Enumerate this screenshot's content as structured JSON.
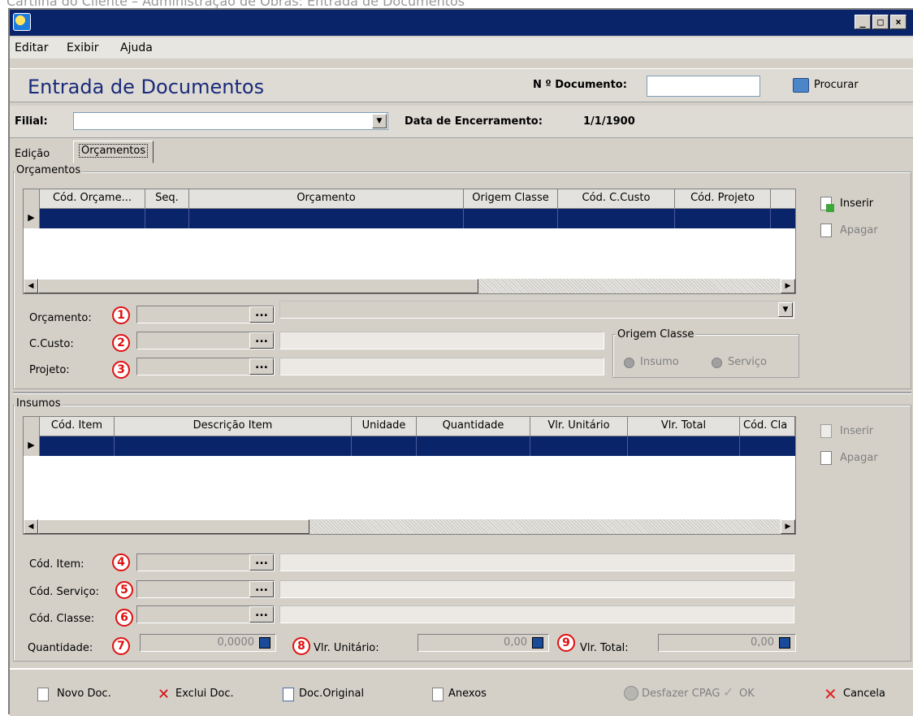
{
  "caption": "Cartilha do Cliente – Administração de Obras: Entrada de Documentos",
  "window": {
    "min_label": "_",
    "max_label": "□",
    "close_label": "×"
  },
  "menu": [
    "Editar",
    "Exibir",
    "Ajuda"
  ],
  "header": {
    "title": "Entrada de Documentos",
    "doc_number_label": "N º Documento:",
    "doc_number_value": "",
    "search_label": "Procurar"
  },
  "filter": {
    "filial_label": "Filial:",
    "filial_value": "",
    "closing_label": "Data de Encerramento:",
    "closing_value": "1/1/1900"
  },
  "tabs": [
    "Edição",
    "Orçamentos"
  ],
  "orcamentos": {
    "title": "Orçamentos",
    "columns": [
      "Cód. Orçame...",
      "Seq.",
      "Orçamento",
      "Origem Classe",
      "Cód. C.Custo",
      "Cód. Projeto"
    ],
    "insert_label": "Inserir",
    "delete_label": "Apagar",
    "fields": [
      {
        "label": "Orçamento:",
        "badge": "1"
      },
      {
        "label": "C.Custo:",
        "badge": "2"
      },
      {
        "label": "Projeto:",
        "badge": "3"
      }
    ],
    "origem_title": "Origem Classe",
    "origem_options": [
      "Insumo",
      "Serviço"
    ]
  },
  "insumos": {
    "title": "Insumos",
    "columns": [
      "Cód. Item",
      "Descrição Item",
      "Unidade",
      "Quantidade",
      "Vlr. Unitário",
      "Vlr. Total",
      "Cód. Cla"
    ],
    "insert_label": "Inserir",
    "delete_label": "Apagar",
    "fields": [
      {
        "label": "Cód. Item:",
        "badge": "4"
      },
      {
        "label": "Cód. Serviço:",
        "badge": "5"
      },
      {
        "label": "Cód. Classe:",
        "badge": "6"
      }
    ],
    "quantidade_label": "Quantidade:",
    "quantidade_value": "0,0000",
    "quantidade_badge": "7",
    "unitario_label": "Vlr. Unitário:",
    "unitario_value": "0,00",
    "unitario_badge": "8",
    "total_label": "Vlr. Total:",
    "total_value": "0,00",
    "total_badge": "9"
  },
  "dots": "...",
  "footer": {
    "novo": "Novo Doc.",
    "exclui": "Exclui Doc.",
    "original": "Doc.Original",
    "anexos": "Anexos",
    "desfazer": "Desfazer CPAG",
    "ok": "OK",
    "cancela": "Cancela"
  },
  "colors": {
    "titlebar": "#0a246a",
    "selected_row": "#0a246a",
    "title_text": "#1a2a7a",
    "badge": "#e01010"
  }
}
